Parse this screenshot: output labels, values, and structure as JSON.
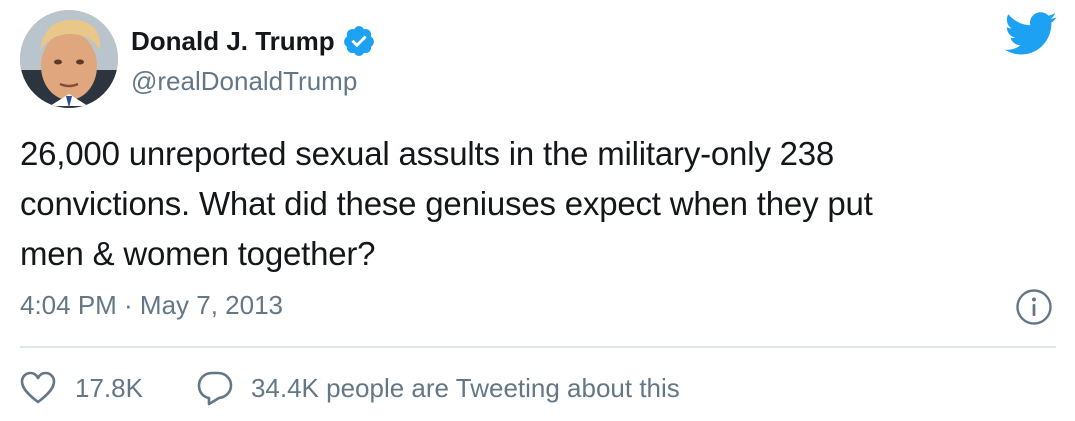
{
  "tweet": {
    "author": {
      "display_name": "Donald J. Trump",
      "handle": "@realDonaldTrump",
      "verified": true
    },
    "text_lines": [
      "26,000 unreported sexual assults in the military-only 238",
      "convictions. What did these geniuses expect when they put",
      "men & women together?"
    ],
    "timestamp": "4:04 PM · May 7, 2013",
    "likes": "17.8K",
    "conversation": "34.4K people are Tweeting about this"
  },
  "icons": {
    "logo": "twitter-bird-icon",
    "verified": "verified-badge-icon",
    "info": "info-icon",
    "like": "heart-icon",
    "reply": "speech-bubble-icon"
  },
  "colors": {
    "brand": "#1da1f2",
    "text": "#14171a",
    "secondary": "#657786",
    "divider": "#e1e8ed"
  }
}
